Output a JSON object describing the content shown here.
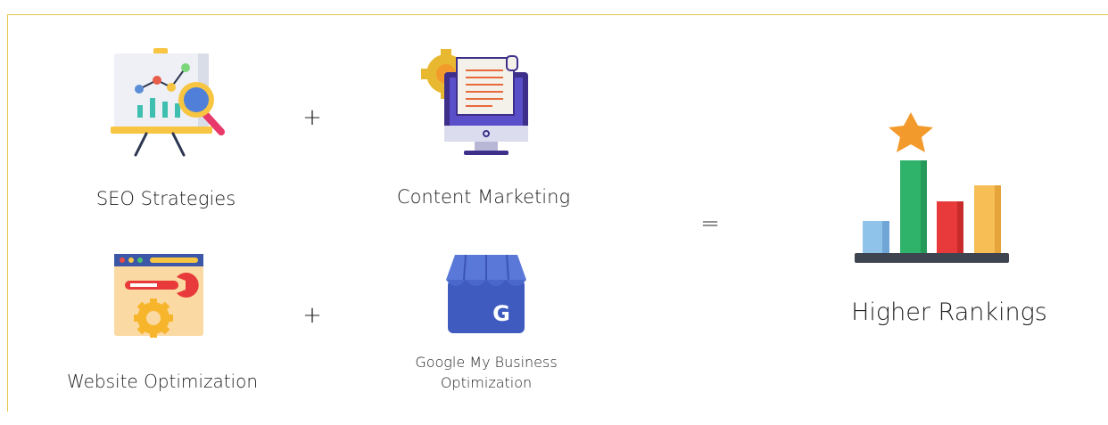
{
  "items": [
    {
      "label": "SEO Strategies",
      "icon": "seo-presentation-chart-icon"
    },
    {
      "label": "Content Marketing",
      "icon": "content-monitor-document-icon"
    },
    {
      "label": "Website Optimization",
      "icon": "website-wrench-gear-icon"
    },
    {
      "label_line1": "Google My Business",
      "label_line2": "Optimization",
      "icon": "google-my-business-store-icon"
    }
  ],
  "operators": {
    "plus": "+",
    "equals": "="
  },
  "result": {
    "label": "Higher Rankings",
    "icon": "bar-chart-star-icon"
  },
  "colors": {
    "frame": "#e3c84a",
    "blue": "#4a5db8",
    "orange": "#f39a2c",
    "green": "#2fb36b",
    "red": "#e83a3a",
    "light_blue": "#8fc3ea",
    "yellow": "#f7be56"
  }
}
